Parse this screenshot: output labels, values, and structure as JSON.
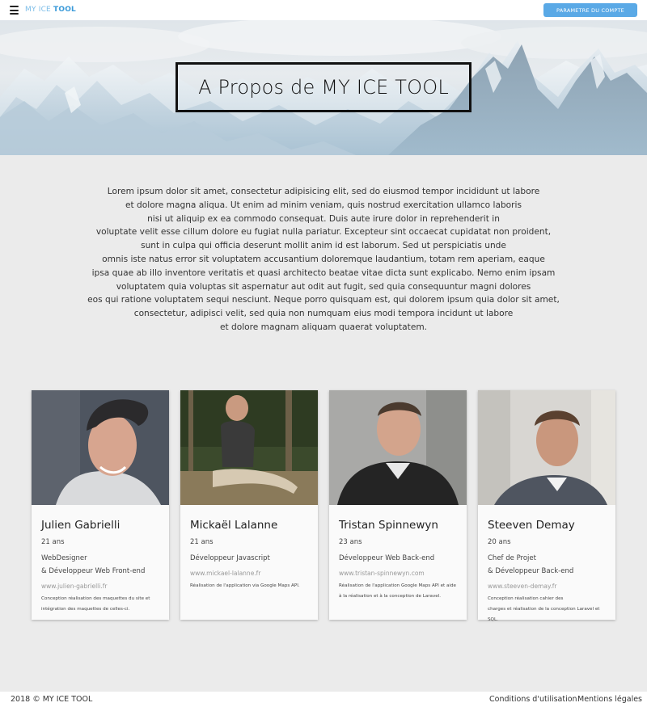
{
  "nav": {
    "menu_icon": "hamburger-icon",
    "brand_part1": "MY ICE",
    "brand_part2": "TOOL",
    "account_button": "PARAMETRE DU COMPTE"
  },
  "hero": {
    "title": "A Propos de MY ICE TOOL"
  },
  "intro": {
    "lines": [
      "Lorem ipsum dolor sit amet, consectetur adipisicing elit, sed do eiusmod tempor incididunt ut labore",
      "et dolore magna aliqua. Ut enim ad minim veniam, quis nostrud exercitation ullamco laboris",
      "nisi ut aliquip ex ea commodo consequat. Duis aute irure dolor in reprehenderit in",
      "voluptate velit esse cillum dolore eu fugiat nulla pariatur. Excepteur sint occaecat cupidatat non proident,",
      "sunt in culpa qui officia deserunt mollit anim id est laborum. Sed ut perspiciatis unde",
      "omnis iste natus error sit voluptatem accusantium doloremque laudantium, totam rem aperiam, eaque",
      "ipsa quae ab illo inventore veritatis et quasi architecto beatae vitae dicta sunt explicabo. Nemo enim ipsam",
      "voluptatem quia voluptas sit aspernatur aut odit aut fugit, sed quia consequuntur magni dolores",
      "eos qui ratione voluptatem sequi nesciunt. Neque porro quisquam est, qui dolorem ipsum quia dolor sit amet,",
      "consectetur, adipisci velit, sed quia non numquam eius modi tempora incidunt ut labore",
      "et dolore magnam aliquam quaerat voluptatem."
    ]
  },
  "team": [
    {
      "name": "Julien Gabrielli",
      "age": "21 ans",
      "role1": "WebDesigner",
      "role2": "& Développeur Web Front-end",
      "site": "www.julien-gabrielli.fr",
      "desc1": "Conception réalisation des maquettes du site et",
      "desc2": "intégration des maquettes de celles-ci."
    },
    {
      "name": "Mickaël Lalanne",
      "age": "21 ans",
      "role1": "Développeur Javascript",
      "role2": "",
      "site": "www.mickael-lalanne.fr",
      "desc1": "Réalisation de l'application via Google Maps API.",
      "desc2": ""
    },
    {
      "name": "Tristan Spinnewyn",
      "age": "23 ans",
      "role1": "Développeur Web Back-end",
      "role2": "",
      "site": "www.tristan-spinnewyn.com",
      "desc1": "Réalisation de l'application Google Maps API et aide",
      "desc2": "à la réalisation et à la conception de Laravel."
    },
    {
      "name": "Steeven Demay",
      "age": "20 ans",
      "role1": "Chef de Projet",
      "role2": "& Développeur Back-end",
      "site": "www.steeven-demay.fr",
      "desc1": "Conception réalisation cahier des",
      "desc2": "charges et réalisation de la conception Laravel et SQL."
    }
  ],
  "footer": {
    "copyright": "2018 © MY ICE TOOL",
    "terms": "Conditions d'utilisation",
    "legal": "Mentions légales"
  }
}
